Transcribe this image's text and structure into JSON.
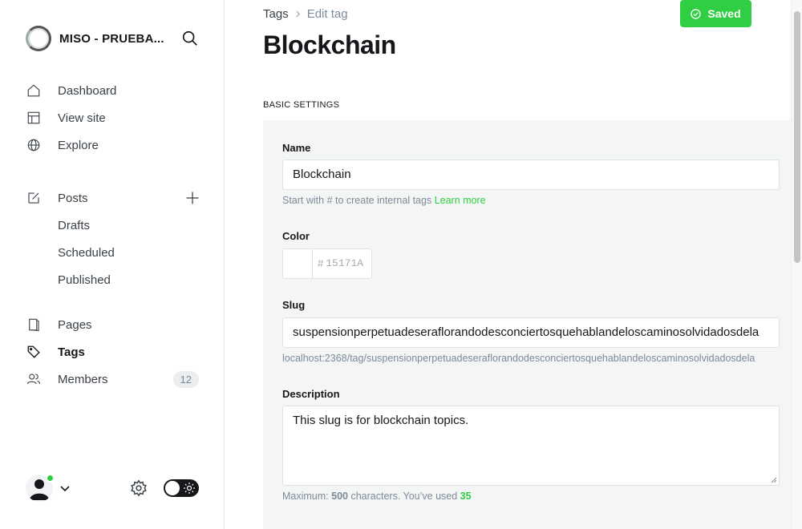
{
  "sidebar": {
    "brand_name": "MISO - PRUEBA...",
    "nav_primary": [
      {
        "label": "Dashboard",
        "icon": "home-icon"
      },
      {
        "label": "View site",
        "icon": "layout-icon"
      },
      {
        "label": "Explore",
        "icon": "globe-icon"
      }
    ],
    "posts": {
      "label": "Posts",
      "sub": [
        "Drafts",
        "Scheduled",
        "Published"
      ]
    },
    "nav_secondary": [
      {
        "label": "Pages",
        "icon": "page-icon"
      },
      {
        "label": "Tags",
        "icon": "tag-icon",
        "active": true
      },
      {
        "label": "Members",
        "icon": "members-icon",
        "badge": "12"
      }
    ]
  },
  "header": {
    "breadcrumb_parent": "Tags",
    "breadcrumb_current": "Edit tag",
    "saved_label": "Saved",
    "title": "Blockchain"
  },
  "form": {
    "section_title": "BASIC SETTINGS",
    "name_label": "Name",
    "name_value": "Blockchain",
    "name_hint": "Start with # to create internal tags ",
    "name_hint_link": "Learn more",
    "color_label": "Color",
    "color_hash": "#",
    "color_value": "15171A",
    "slug_label": "Slug",
    "slug_value": "suspensionperpetuadeseraflorandodesconciertosquehablandeloscaminosolvidadosdela",
    "slug_url": "localhost:2368/tag/suspensionperpetuadeseraflorandodesconciertosquehablandeloscaminosolvidadosdela",
    "description_label": "Description",
    "description_value": "This slug is for blockchain topics.",
    "count_prefix": "Maximum: ",
    "count_max": "500",
    "count_mid": " characters. You’ve used ",
    "count_used": "35"
  },
  "colors": {
    "accent": "#30cf43",
    "text": "#15171a",
    "muted": "#7c8b9a",
    "panel": "#f4f5f5"
  }
}
